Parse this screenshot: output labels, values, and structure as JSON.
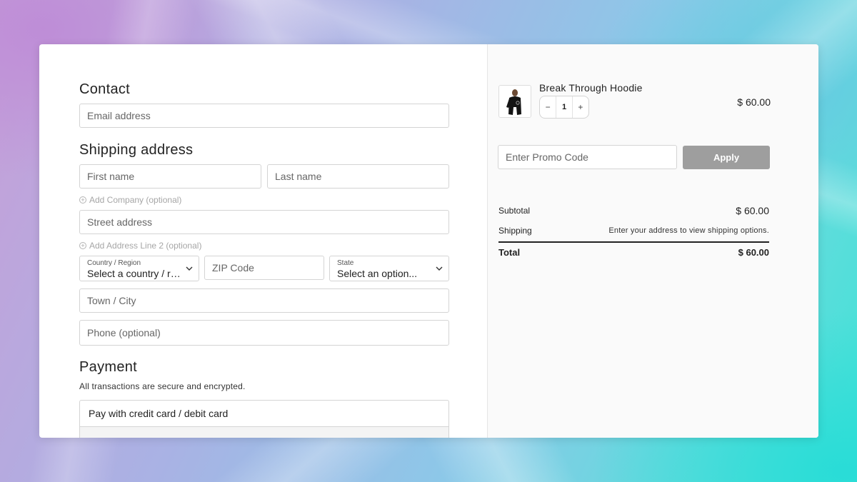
{
  "contact": {
    "heading": "Contact",
    "email_placeholder": "Email address"
  },
  "shipping": {
    "heading": "Shipping address",
    "first_name_placeholder": "First name",
    "last_name_placeholder": "Last name",
    "add_company": "Add Company (optional)",
    "street_placeholder": "Street address",
    "add_address_line2": "Add Address Line 2 (optional)",
    "country_label": "Country / Region",
    "country_value": "Select a country / region...",
    "zip_placeholder": "ZIP Code",
    "state_label": "State",
    "state_value": "Select an option...",
    "city_placeholder": "Town / City",
    "phone_placeholder": "Phone (optional)"
  },
  "payment": {
    "heading": "Payment",
    "subtext": "All transactions are secure and encrypted.",
    "method_label": "Pay with credit card / debit card"
  },
  "cart": {
    "product_name": "Break Through Hoodie",
    "quantity": "1",
    "minus": "−",
    "plus": "+",
    "price": "$ 60.00"
  },
  "promo": {
    "placeholder": "Enter Promo Code",
    "apply_label": "Apply"
  },
  "summary": {
    "subtotal_label": "Subtotal",
    "subtotal_value": "$ 60.00",
    "shipping_label": "Shipping",
    "shipping_note": "Enter your address to view shipping options.",
    "total_label": "Total",
    "total_value": "$ 60.00"
  },
  "colors": {
    "apply_button": "#9e9e9e",
    "panel_bg": "#fafafa",
    "border": "#d4d4d4"
  },
  "icons": {
    "add_company": "plus-circle-icon",
    "add_line2": "plus-circle-icon",
    "dropdown": "chevron-down-icon"
  }
}
